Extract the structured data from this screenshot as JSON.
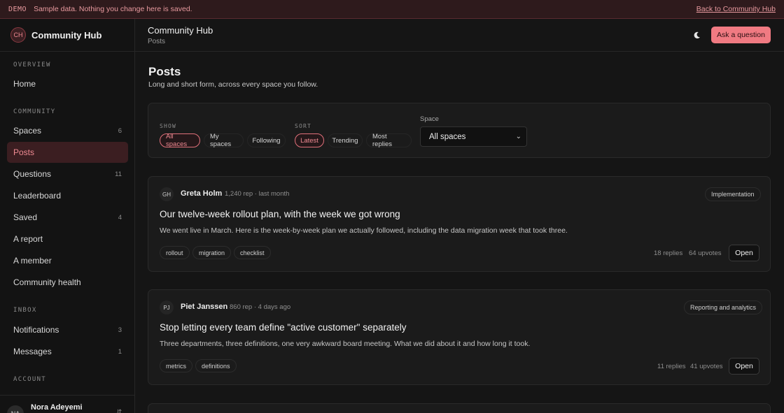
{
  "demo": {
    "tag": "DEMO",
    "message": "Sample data. Nothing you change here is saved.",
    "back_link": "Back to Community Hub"
  },
  "brand": {
    "initials": "CH",
    "name": "Community Hub"
  },
  "sidebar": {
    "sections": {
      "overview": "OVERVIEW",
      "community": "COMMUNITY",
      "inbox": "INBOX",
      "account": "ACCOUNT"
    },
    "items": [
      {
        "label": "Home",
        "count": ""
      },
      {
        "label": "Spaces",
        "count": "6"
      },
      {
        "label": "Posts",
        "count": ""
      },
      {
        "label": "Questions",
        "count": "11"
      },
      {
        "label": "Leaderboard",
        "count": ""
      },
      {
        "label": "Saved",
        "count": "4"
      },
      {
        "label": "A report",
        "count": ""
      },
      {
        "label": "A member",
        "count": ""
      },
      {
        "label": "Community health",
        "count": ""
      },
      {
        "label": "Notifications",
        "count": "3"
      },
      {
        "label": "Messages",
        "count": "1"
      }
    ],
    "user": {
      "initials": "NA",
      "name": "Nora Adeyemi",
      "menu_icon": "expand-icon"
    }
  },
  "topbar": {
    "title": "Community Hub",
    "breadcrumb": "Posts",
    "theme_icon": "moon-icon",
    "ask_button": "Ask a question"
  },
  "page": {
    "title": "Posts",
    "subtitle": "Long and short form, across every space you follow."
  },
  "filters": {
    "show_label": "SHOW",
    "show_options": [
      "All spaces",
      "My spaces",
      "Following"
    ],
    "show_selected": "All spaces",
    "sort_label": "SORT",
    "sort_options": [
      "Latest",
      "Trending",
      "Most replies"
    ],
    "sort_selected": "Latest",
    "space_label": "Space",
    "space_value": "All spaces"
  },
  "posts": [
    {
      "initials": "GH",
      "author": "Greta Holm",
      "meta": "1,240 rep · last month",
      "space": "Implementation",
      "title": "Our twelve-week rollout plan, with the week we got wrong",
      "body": "We went live in March. Here is the week-by-week plan we actually followed, including the data migration week that took three.",
      "tags": [
        "rollout",
        "migration",
        "checklist"
      ],
      "replies": "18 replies",
      "upvotes": "64 upvotes",
      "open_label": "Open"
    },
    {
      "initials": "PJ",
      "author": "Piet Janssen",
      "meta": "860 rep · 4 days ago",
      "space": "Reporting and analytics",
      "title": "Stop letting every team define \"active customer\" separately",
      "body": "Three departments, three definitions, one very awkward board meeting. What we did about it and how long it took.",
      "tags": [
        "metrics",
        "definitions"
      ],
      "replies": "11 replies",
      "upvotes": "41 upvotes",
      "open_label": "Open"
    }
  ]
}
